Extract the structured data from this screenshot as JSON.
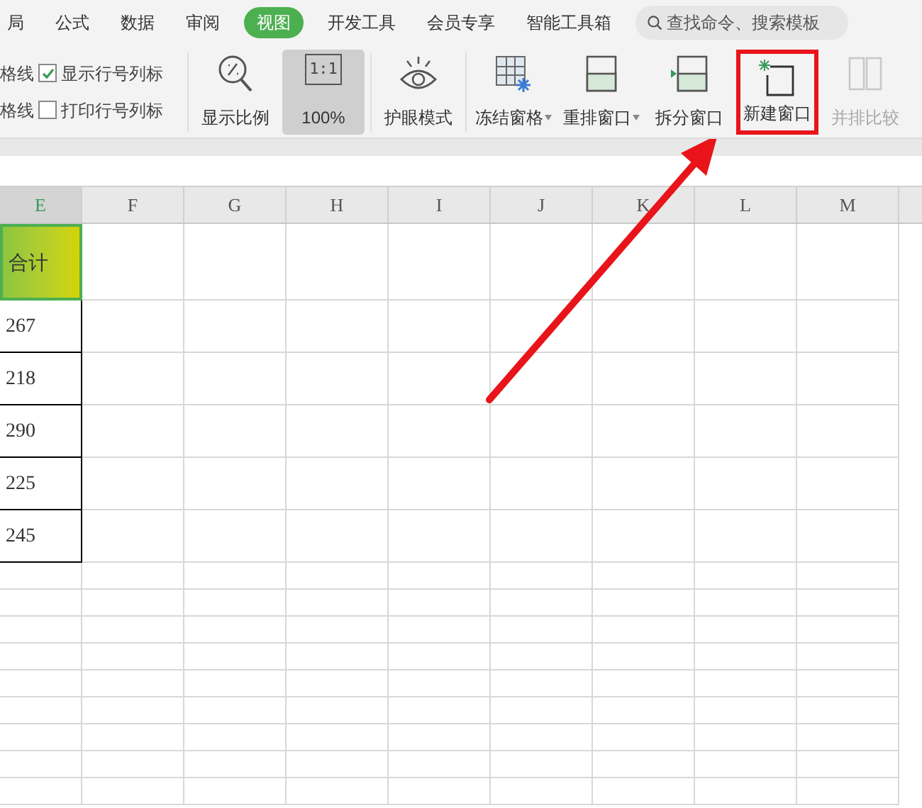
{
  "menu_tabs": [
    {
      "label": "局",
      "selected": false
    },
    {
      "label": "公式",
      "selected": false
    },
    {
      "label": "数据",
      "selected": false
    },
    {
      "label": "审阅",
      "selected": false
    },
    {
      "label": "视图",
      "selected": true
    },
    {
      "label": "开发工具",
      "selected": false
    },
    {
      "label": "会员专享",
      "selected": false
    },
    {
      "label": "智能工具箱",
      "selected": false
    }
  ],
  "search": {
    "placeholder": "查找命令、搜索模板"
  },
  "ribbon": {
    "options": [
      {
        "cut_label": "格线",
        "label": "显示行号列标",
        "checked": true
      },
      {
        "cut_label": "格线",
        "label": "打印行号列标",
        "checked": false
      }
    ],
    "groups": [
      {
        "buttons": [
          {
            "kind": "zoom",
            "label": "显示比例",
            "selected": false,
            "disabled": false,
            "dropdown": false,
            "highlighted": false
          },
          {
            "kind": "actual",
            "label": "100%",
            "icon_text": "1:1",
            "selected": true,
            "disabled": false,
            "dropdown": false,
            "highlighted": false
          }
        ]
      },
      {
        "buttons": [
          {
            "kind": "eye",
            "label": "护眼模式",
            "selected": false,
            "disabled": false,
            "dropdown": false,
            "highlighted": false
          }
        ]
      },
      {
        "buttons": [
          {
            "kind": "freeze",
            "label": "冻结窗格",
            "selected": false,
            "disabled": false,
            "dropdown": true,
            "highlighted": false
          },
          {
            "kind": "arrange",
            "label": "重排窗口",
            "selected": false,
            "disabled": false,
            "dropdown": true,
            "highlighted": false
          },
          {
            "kind": "split",
            "label": "拆分窗口",
            "selected": false,
            "disabled": false,
            "dropdown": false,
            "highlighted": false
          },
          {
            "kind": "new",
            "label": "新建窗口",
            "selected": false,
            "disabled": false,
            "dropdown": false,
            "highlighted": true
          },
          {
            "kind": "compare",
            "label": "并排比较",
            "selected": false,
            "disabled": true,
            "dropdown": false,
            "highlighted": false
          }
        ]
      }
    ]
  },
  "sheet": {
    "columns": [
      {
        "label": "E",
        "selected": true
      },
      {
        "label": "F",
        "selected": false
      },
      {
        "label": "G",
        "selected": false
      },
      {
        "label": "H",
        "selected": false
      },
      {
        "label": "I",
        "selected": false
      },
      {
        "label": "J",
        "selected": false
      },
      {
        "label": "K",
        "selected": false
      },
      {
        "label": "L",
        "selected": false
      },
      {
        "label": "M",
        "selected": false
      }
    ],
    "cells": [
      {
        "text": "合计",
        "selected": true
      },
      {
        "text": "267",
        "selected": false
      },
      {
        "text": "218",
        "selected": false
      },
      {
        "text": "290",
        "selected": false
      },
      {
        "text": "225",
        "selected": false
      },
      {
        "text": "245",
        "selected": false
      }
    ]
  }
}
